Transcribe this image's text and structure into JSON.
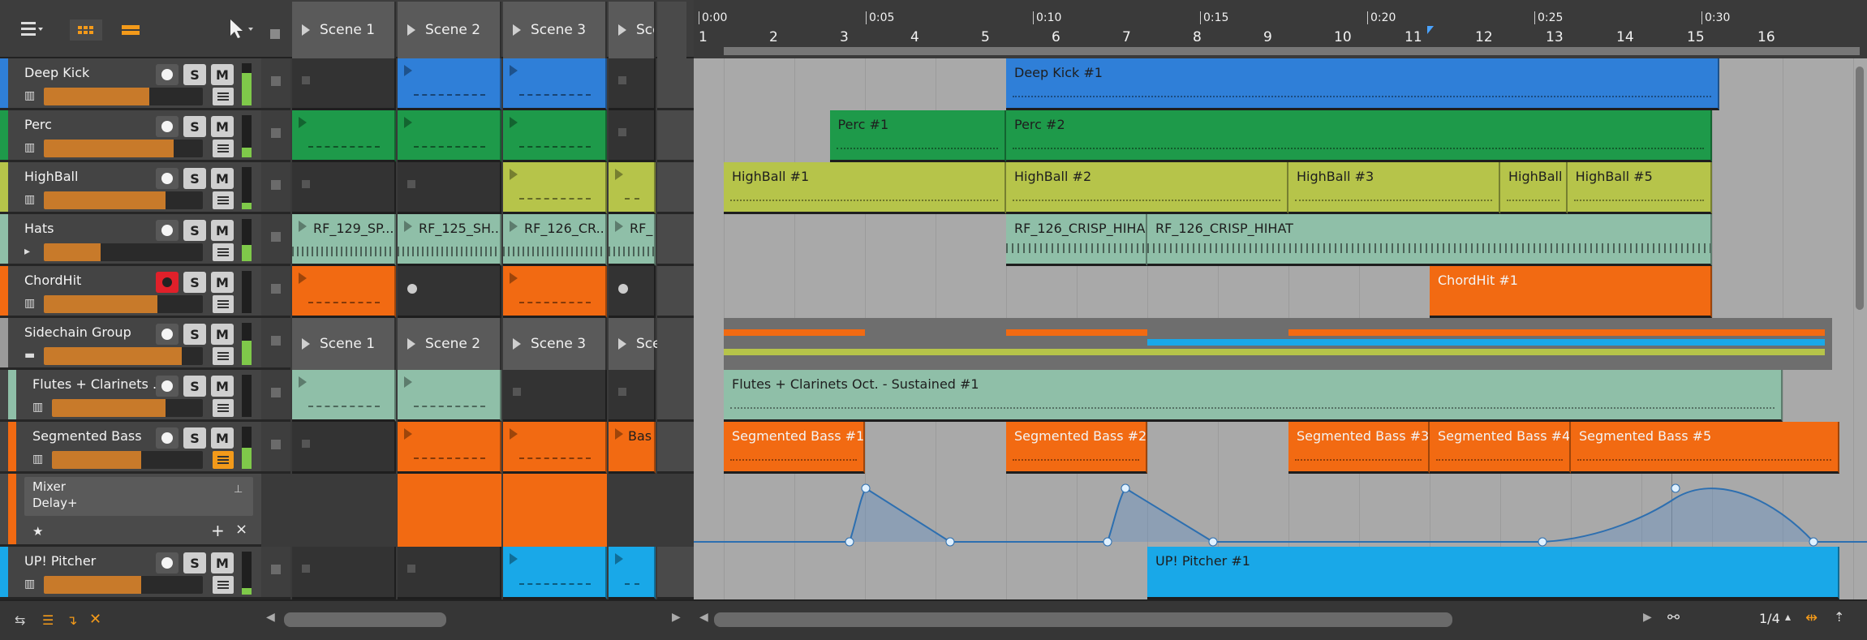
{
  "toolbar": {
    "menu_icon": "list-menu-icon",
    "view_grid_icon": "clip-grid-icon",
    "view_lines_icon": "arrange-lines-icon",
    "pointer_icon": "pointer-tool-icon"
  },
  "scenes": [
    "Scene 1",
    "Scene 2",
    "Scene 3",
    "Sce"
  ],
  "group_scenes": [
    "Scene 1",
    "Scene 2",
    "Scene 3",
    "Sce"
  ],
  "ruler": {
    "bars": [
      "1",
      "2",
      "3",
      "4",
      "5",
      "6",
      "7",
      "8",
      "9",
      "10",
      "11",
      "12",
      "13",
      "14",
      "15",
      "16"
    ],
    "times": [
      "0:00",
      "0:05",
      "0:10",
      "0:15",
      "0:20",
      "0:25",
      "0:30"
    ]
  },
  "tracks": [
    {
      "name": "Deep Kick",
      "color": "#2f7fd8",
      "mute": "M",
      "solo": "S"
    },
    {
      "name": "Perc",
      "color": "#1e9a4a",
      "mute": "M",
      "solo": "S"
    },
    {
      "name": "HighBall",
      "color": "#b6c44a",
      "mute": "M",
      "solo": "S"
    },
    {
      "name": "Hats",
      "color": "#8fbfa8",
      "mute": "M",
      "solo": "S"
    },
    {
      "name": "ChordHit",
      "color": "#f26a12",
      "mute": "M",
      "solo": "S"
    },
    {
      "name": "Sidechain Group",
      "color": "#9a9a9a",
      "mute": "M",
      "solo": "S"
    },
    {
      "name": "Flutes + Clarinets ...",
      "color": "#8fbfa8",
      "mute": "M",
      "solo": "S"
    },
    {
      "name": "Segmented Bass",
      "color": "#f26a12",
      "mute": "M",
      "solo": "S"
    },
    {
      "name": "UP! Pitcher",
      "color": "#19a8e8",
      "mute": "M",
      "solo": "S"
    }
  ],
  "automation_lane": {
    "param_1": "Mixer",
    "param_2": "Delay+",
    "add": "+",
    "remove": "×",
    "star": "★"
  },
  "launcher_clips": {
    "hats": [
      "RF_129_SP...",
      "RF_125_SH...",
      "RF_126_CR...",
      "RF_"
    ],
    "segbass_last": "Bas"
  },
  "arranger_clips": {
    "deep_kick": [
      "Deep Kick #1"
    ],
    "perc": [
      "Perc #1",
      "Perc #2"
    ],
    "highball": [
      "HighBall #1",
      "HighBall #2",
      "HighBall #3",
      "HighBall #4",
      "HighBall #5"
    ],
    "hats": [
      "RF_126_CRISP_HIHA",
      "RF_126_CRISP_HIHAT"
    ],
    "chordhit": [
      "ChordHit #1"
    ],
    "flutes": [
      "Flutes + Clarinets Oct. - Sustained #1"
    ],
    "segbass": [
      "Segmented Bass #1",
      "Segmented Bass #2",
      "Segmented Bass #3",
      "Segmented Bass #4",
      "Segmented Bass #5"
    ],
    "pitcher": [
      "UP! Pitcher #1"
    ]
  },
  "status": {
    "grid_value": "1/4"
  }
}
